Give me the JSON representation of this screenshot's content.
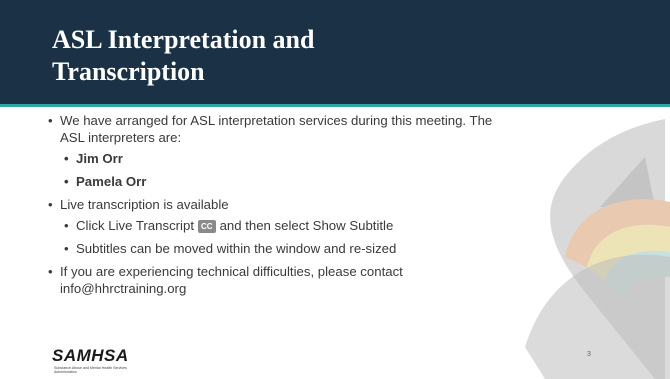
{
  "slide": {
    "title": "ASL Interpretation and Transcription",
    "bullets": {
      "asl_intro": "We have arranged for ASL interpretation services during this meeting. The ASL interpreters are:",
      "interpreters": [
        "Jim Orr",
        "Pamela Orr"
      ],
      "transcription": "Live transcription is available",
      "click_prefix": "Click Live Transcript",
      "cc_label": "CC",
      "click_suffix": "and then select Show Subtitle",
      "subtitles": "Subtitles can be moved within the window and re-sized",
      "tech_support": "If you are experiencing technical difficulties, please contact info@hhrctraining.org"
    },
    "page_number": "3"
  },
  "logo": {
    "name": "SAMHSA",
    "subtitle": "Substance Abuse and Mental Health Services Administration"
  },
  "colors": {
    "header_bg": "#1b3246",
    "accent": "#2fa6a8",
    "text": "#3a3a3a"
  }
}
